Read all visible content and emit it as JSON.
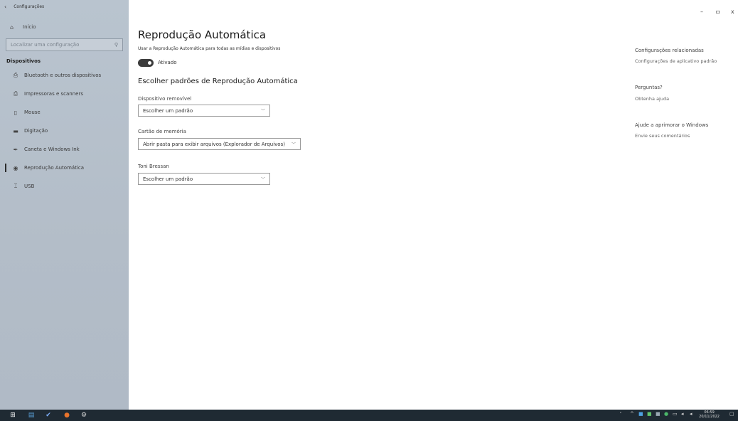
{
  "window": {
    "title": "Configurações",
    "back_icon": "back-arrow-icon",
    "minimize": "–",
    "restore": "ㅁ",
    "close": "x"
  },
  "sidebar": {
    "home_label": "Início",
    "search_placeholder": "Localizar uma configuração",
    "section": "Dispositivos",
    "items": [
      {
        "label": "Bluetooth e outros dispositivos",
        "icon": "bluetooth-devices-icon"
      },
      {
        "label": "Impressoras e scanners",
        "icon": "printer-icon"
      },
      {
        "label": "Mouse",
        "icon": "mouse-icon"
      },
      {
        "label": "Digitação",
        "icon": "keyboard-icon"
      },
      {
        "label": "Caneta e Windows Ink",
        "icon": "pen-icon"
      },
      {
        "label": "Reprodução Automática",
        "icon": "autoplay-icon",
        "selected": true
      },
      {
        "label": "USB",
        "icon": "usb-icon"
      }
    ]
  },
  "main": {
    "title": "Reprodução Automática",
    "toggle_description": "Usar a Reprodução Automática para todas as mídias e dispositivos",
    "toggle_state": "Ativado",
    "defaults_title": "Escolher padrões de Reprodução Automática",
    "fields": [
      {
        "label": "Dispositivo removível",
        "value": "Escolher um padrão"
      },
      {
        "label": "Cartão de memória",
        "value": "Abrir pasta para exibir arquivos (Explorador de Arquivos)"
      },
      {
        "label": "Toni Bressan",
        "value": "Escolher um padrão"
      }
    ]
  },
  "right": {
    "related_title": "Configurações relacionadas",
    "related_link": "Configurações de aplicativo padrão",
    "questions_title": "Perguntas?",
    "questions_link": "Obtenha ajuda",
    "improve_title": "Ajude a aprimorar o Windows",
    "improve_link": "Envie seus comentários"
  },
  "taskbar": {
    "time": "06:59",
    "date": "20/11/2022",
    "colors": {
      "bg": "#1f2a33",
      "start": "#ffffff"
    }
  }
}
